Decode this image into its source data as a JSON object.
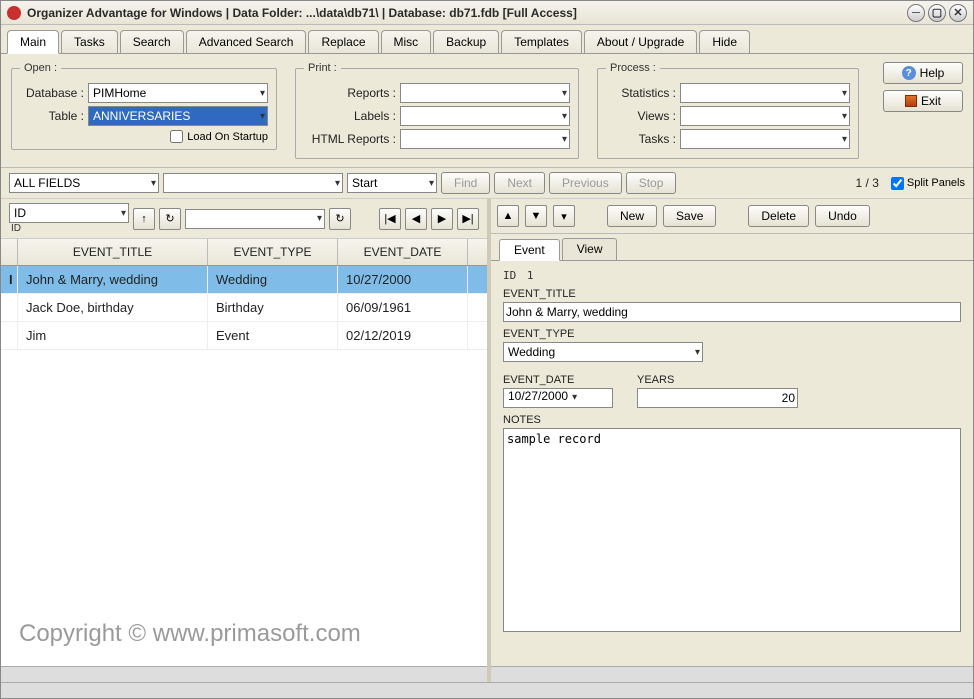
{
  "title": "Organizer Advantage for Windows | Data Folder: ...\\data\\db71\\ | Database: db71.fdb [Full Access]",
  "tabs": [
    "Main",
    "Tasks",
    "Search",
    "Advanced Search",
    "Replace",
    "Misc",
    "Backup",
    "Templates",
    "About / Upgrade",
    "Hide"
  ],
  "activeTab": 0,
  "open": {
    "legend": "Open :",
    "database_label": "Database :",
    "table_label": "Table :",
    "database": "PIMHome",
    "table": "ANNIVERSARIES",
    "load_on_startup_label": "Load On Startup",
    "load_on_startup": false
  },
  "print": {
    "legend": "Print :",
    "reports_label": "Reports :",
    "labels_label": "Labels :",
    "html_label": "HTML Reports :",
    "reports": "",
    "labels": "",
    "html": ""
  },
  "process": {
    "legend": "Process :",
    "stats_label": "Statistics :",
    "views_label": "Views :",
    "tasks_label": "Tasks :",
    "stats": "",
    "views": "",
    "tasks": ""
  },
  "side_buttons": {
    "help": "Help",
    "exit": "Exit"
  },
  "search": {
    "field_selector": "ALL FIELDS",
    "term": "",
    "mode": "Start",
    "find": "Find",
    "next": "Next",
    "prev": "Previous",
    "stop": "Stop",
    "pager": "1 / 3",
    "split_label": "Split Panels",
    "split_checked": true
  },
  "sort": {
    "field": "ID",
    "sublabel": "ID",
    "field2": ""
  },
  "grid": {
    "columns": [
      "EVENT_TITLE",
      "EVENT_TYPE",
      "EVENT_DATE"
    ],
    "rows": [
      {
        "title": "John & Marry, wedding",
        "type": "Wedding",
        "date": "10/27/2000",
        "selected": true
      },
      {
        "title": "Jack Doe, birthday",
        "type": "Birthday",
        "date": "06/09/1961",
        "selected": false
      },
      {
        "title": "Jim",
        "type": "Event",
        "date": "02/12/2019",
        "selected": false
      }
    ]
  },
  "watermark": "Copyright ©   www.primasoft.com",
  "actions": {
    "new": "New",
    "save": "Save",
    "delete": "Delete",
    "undo": "Undo"
  },
  "subtabs": [
    "Event",
    "View"
  ],
  "activeSubtab": 0,
  "form": {
    "id_label": "ID",
    "id_value": "1",
    "event_title_label": "EVENT_TITLE",
    "event_title": "John & Marry, wedding",
    "event_type_label": "EVENT_TYPE",
    "event_type": "Wedding",
    "event_date_label": "EVENT_DATE",
    "event_date": "10/27/2000",
    "years_label": "YEARS",
    "years": "20",
    "notes_label": "NOTES",
    "notes": "sample record"
  }
}
